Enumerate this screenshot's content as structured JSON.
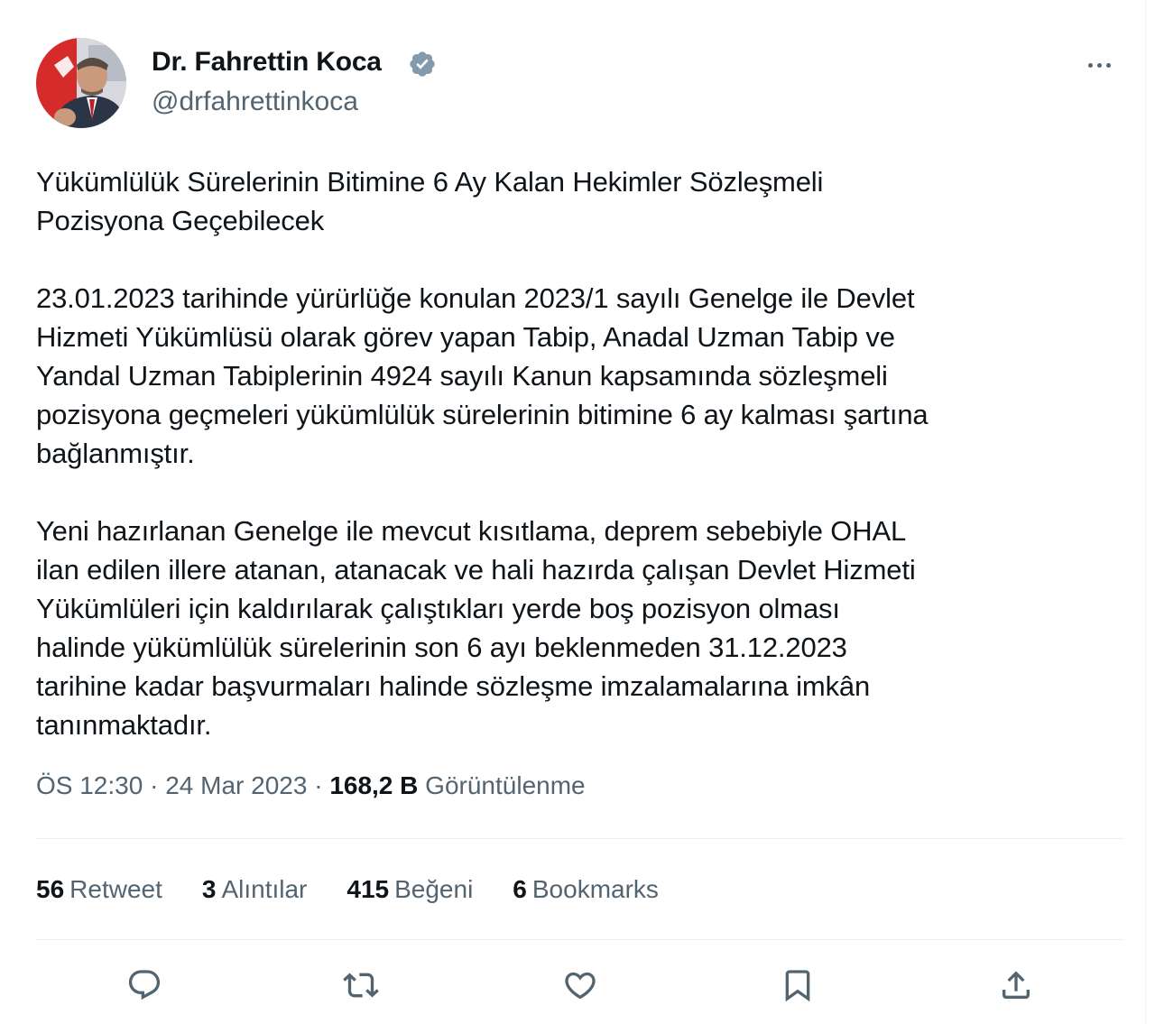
{
  "author": {
    "display_name": "Dr. Fahrettin Koca",
    "handle": "@drfahrettinkoca",
    "verified_icon": "verified-badge-icon",
    "avatar": "profile-photo"
  },
  "tweet": {
    "text": "Yükümlülük Sürelerinin Bitimine 6 Ay Kalan Hekimler Sözleşmeli\nPozisyona Geçebilecek\n\n23.01.2023 tarihinde yürürlüğe konulan 2023/1 sayılı Genelge ile Devlet\nHizmeti Yükümlüsü olarak görev yapan Tabip, Anadal Uzman Tabip ve\nYandal Uzman Tabiplerinin 4924 sayılı Kanun kapsamında sözleşmeli\npozisyona geçmeleri yükümlülük sürelerinin bitimine 6 ay kalması şartına\nbağlanmıştır.\n\nYeni hazırlanan Genelge ile mevcut kısıtlama, deprem sebebiyle OHAL\nilan edilen illere atanan, atanacak ve hali hazırda çalışan Devlet Hizmeti\nYükümlüleri için kaldırılarak çalıştıkları yerde boş pozisyon olması\nhalinde yükümlülük sürelerinin son 6 ayı beklenmeden 31.12.2023\ntarihine kadar başvurmaları halinde sözleşme imzalamalarına imkân\ntanınmaktadır."
  },
  "meta": {
    "time": "ÖS 12:30",
    "separator": " · ",
    "date": "24 Mar 2023",
    "views_count": "168,2 B",
    "views_label": "Görüntülenme"
  },
  "stats": [
    {
      "count": "56",
      "label": "Retweet"
    },
    {
      "count": "3",
      "label": "Alıntılar"
    },
    {
      "count": "415",
      "label": "Beğeni"
    },
    {
      "count": "6",
      "label": "Bookmarks"
    }
  ],
  "actions": [
    "reply-icon",
    "retweet-icon",
    "like-icon",
    "bookmark-icon",
    "share-icon"
  ],
  "colors": {
    "text_primary": "#0f1419",
    "text_secondary": "#536471",
    "verified_blue": "#1d9bf0",
    "divider": "#e6ecf0"
  }
}
